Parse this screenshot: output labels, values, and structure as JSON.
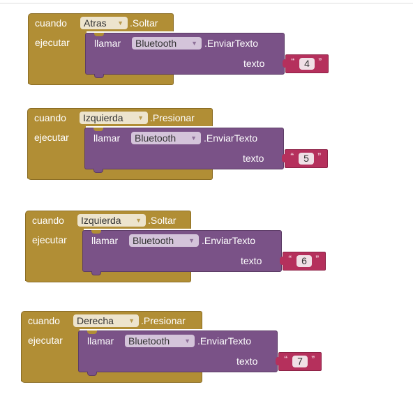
{
  "blocks": [
    {
      "event": "cuando",
      "component": "Atras",
      "action": ".Soltar",
      "exec": "ejecutar",
      "call": "llamar",
      "target": "Bluetooth",
      "method": ".EnviarTexto",
      "param": "texto",
      "value": "4"
    },
    {
      "event": "cuando",
      "component": "Izquierda",
      "action": ".Presionar",
      "exec": "ejecutar",
      "call": "llamar",
      "target": "Bluetooth",
      "method": ".EnviarTexto",
      "param": "texto",
      "value": "5"
    },
    {
      "event": "cuando",
      "component": "Izquierda",
      "action": ".Soltar",
      "exec": "ejecutar",
      "call": "llamar",
      "target": "Bluetooth",
      "method": ".EnviarTexto",
      "param": "texto",
      "value": "6"
    },
    {
      "event": "cuando",
      "component": "Derecha",
      "action": ".Presionar",
      "exec": "ejecutar",
      "call": "llamar",
      "target": "Bluetooth",
      "method": ".EnviarTexto",
      "param": "texto",
      "value": "7"
    }
  ],
  "glyphs": {
    "dropdown_arrow": "▼",
    "quote_open": "“",
    "quote_close": "”"
  },
  "colors": {
    "event_block": "#b18e35",
    "call_block": "#7a5287",
    "text_block": "#b5305c"
  }
}
